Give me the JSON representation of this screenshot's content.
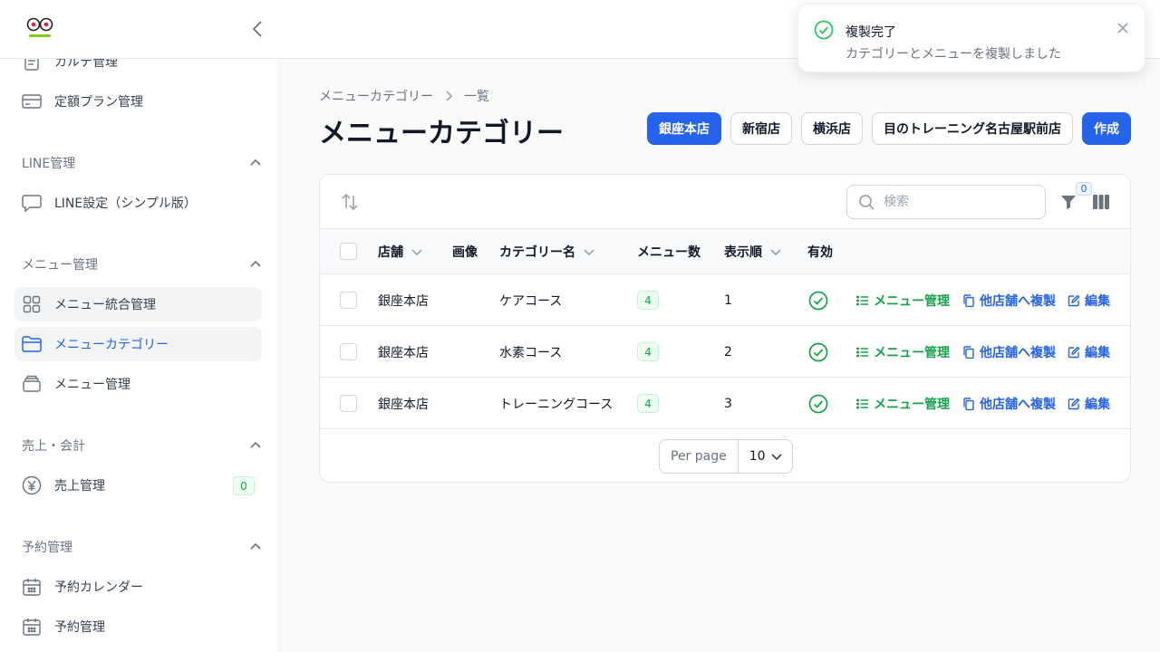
{
  "toast": {
    "title": "複製完了",
    "body": "カテゴリーとメニューを複製しました"
  },
  "sidebar": {
    "items_top": [
      {
        "label": "カルテ管理",
        "icon": "document-icon"
      },
      {
        "label": "定額プラン管理",
        "icon": "credit-card-icon"
      }
    ],
    "groups": [
      {
        "label": "LINE管理",
        "items": [
          {
            "label": "LINE設定（シンプル版）",
            "icon": "chat-bubble-icon"
          }
        ]
      },
      {
        "label": "メニュー管理",
        "items": [
          {
            "label": "メニュー統合管理",
            "icon": "grid-icon"
          },
          {
            "label": "メニューカテゴリー",
            "icon": "folder-icon"
          },
          {
            "label": "メニュー管理",
            "icon": "stack-icon"
          }
        ]
      },
      {
        "label": "売上・会計",
        "items": [
          {
            "label": "売上管理",
            "icon": "yen-icon",
            "badge": "0"
          }
        ]
      },
      {
        "label": "予約管理",
        "items": [
          {
            "label": "予約カレンダー",
            "icon": "calendar-icon"
          },
          {
            "label": "予約管理",
            "icon": "calendar-icon"
          }
        ]
      }
    ]
  },
  "breadcrumb": {
    "parent": "メニューカテゴリー",
    "current": "一覧"
  },
  "page_title": "メニューカテゴリー",
  "actions": {
    "stores": [
      "銀座本店",
      "新宿店",
      "横浜店",
      "目のトレーニング名古屋駅前店"
    ],
    "create": "作成"
  },
  "table": {
    "search_placeholder": "検索",
    "filter_count": "0",
    "headers": {
      "store": "店舗",
      "image": "画像",
      "category": "カテゴリー名",
      "menu_count": "メニュー数",
      "order": "表示順",
      "active": "有効"
    },
    "rows": [
      {
        "store": "銀座本店",
        "category": "ケアコース",
        "menu_count": "4",
        "order": "1",
        "active": true
      },
      {
        "store": "銀座本店",
        "category": "水素コース",
        "menu_count": "4",
        "order": "2",
        "active": true
      },
      {
        "store": "銀座本店",
        "category": "トレーニングコース",
        "menu_count": "4",
        "order": "3",
        "active": true
      }
    ],
    "row_actions": {
      "menu": "メニュー管理",
      "copy": "他店舗へ複製",
      "edit": "編集"
    },
    "per_page_label": "Per page",
    "per_page_value": "10"
  },
  "colors": {
    "primary": "#2563eb",
    "success": "#16a34a"
  }
}
